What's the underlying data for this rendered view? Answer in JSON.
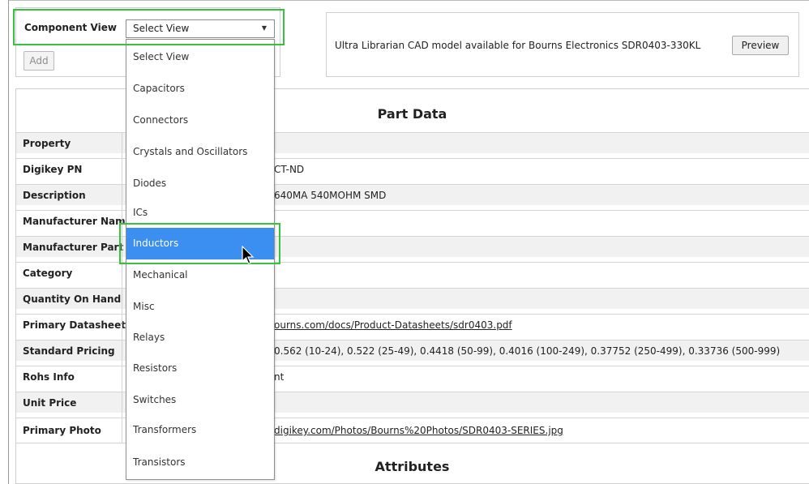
{
  "component_view": {
    "label": "Component View",
    "selected_value": "Select View",
    "add_label": "Add",
    "options": [
      {
        "label": "Select View"
      },
      {
        "label": "Capacitors"
      },
      {
        "label": "Connectors"
      },
      {
        "label": "Crystals and Oscillators"
      },
      {
        "label": "Diodes"
      },
      {
        "label": "ICs"
      },
      {
        "label": "Inductors",
        "highlighted": true
      },
      {
        "label": "Mechanical"
      },
      {
        "label": "Misc"
      },
      {
        "label": "Relays"
      },
      {
        "label": "Resistors"
      },
      {
        "label": "Switches"
      },
      {
        "label": "Transformers"
      },
      {
        "label": "Transistors"
      }
    ]
  },
  "cad": {
    "text": "Ultra Librarian CAD model available for Bourns Electronics SDR0403-330KL",
    "preview_label": "Preview"
  },
  "part_data": {
    "title": "Part Data",
    "rows": [
      {
        "key": "Property",
        "value": ""
      },
      {
        "key": "Digikey PN",
        "value": "CT-ND"
      },
      {
        "key": "Description",
        "value": "640MA 540MOHM SMD"
      },
      {
        "key": "Manufacturer Name",
        "value": ""
      },
      {
        "key": "Manufacturer Part",
        "value": ""
      },
      {
        "key": "Category",
        "value": ""
      },
      {
        "key": "Quantity On Hand",
        "value": ""
      },
      {
        "key": "Primary Datasheet",
        "value": "ourns.com/docs/Product-Datasheets/sdr0403.pdf"
      },
      {
        "key": "Standard Pricing",
        "value": "0.562 (10-24), 0.522 (25-49), 0.4418 (50-99), 0.4016 (100-249), 0.37752 (250-499), 0.33736 (500-999)"
      },
      {
        "key": "Rohs Info",
        "value": "nt"
      },
      {
        "key": "Unit Price",
        "value": ""
      },
      {
        "key": "Primary Photo",
        "value": "digikey.com/Photos/Bourns%20Photos/SDR0403-SERIES.jpg"
      }
    ]
  },
  "attributes": {
    "title": "Attributes"
  },
  "colors": {
    "highlight": "#36c23c",
    "selection": "#3b8ff0",
    "row_alt": "#f1f1f1"
  }
}
